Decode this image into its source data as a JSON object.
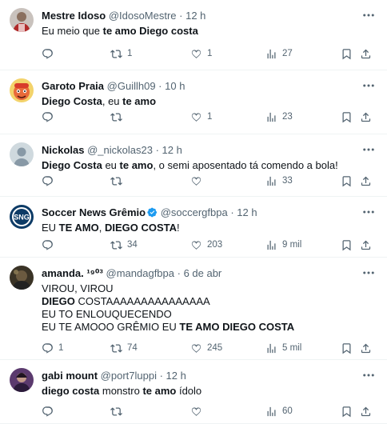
{
  "tweets": [
    {
      "name": "Mestre Idoso",
      "handle": "@IdosoMestre",
      "time": "12 h",
      "avatar": "user-photo",
      "lines": [
        [
          {
            "t": "Eu meio que ",
            "b": false
          },
          {
            "t": "te amo Diego costa",
            "b": true
          }
        ]
      ],
      "replies": "",
      "retweets": "1",
      "likes": "1",
      "views": "27"
    },
    {
      "name": "Garoto Praia",
      "handle": "@Guillh09",
      "time": "10 h",
      "avatar": "cartoon-character",
      "lines": [
        [
          {
            "t": "Diego Costa",
            "b": true
          },
          {
            "t": ", eu ",
            "b": false
          },
          {
            "t": "te amo",
            "b": true
          }
        ]
      ],
      "replies": "",
      "retweets": "",
      "likes": "1",
      "views": "23"
    },
    {
      "name": "Nickolas",
      "handle": "@_nickolas23",
      "time": "12 h",
      "avatar": "default-user",
      "lines": [
        [
          {
            "t": "Diego Costa",
            "b": true
          },
          {
            "t": " eu ",
            "b": false
          },
          {
            "t": "te amo",
            "b": true
          },
          {
            "t": ", o semi aposentado tá comendo a bola!",
            "b": false
          }
        ]
      ],
      "replies": "",
      "retweets": "",
      "likes": "",
      "views": "33"
    },
    {
      "name": "Soccer News Grêmio",
      "handle": "@soccergfbpa",
      "time": "12 h",
      "avatar": "soccer-news-logo",
      "verified": true,
      "lines": [
        [
          {
            "t": "EU ",
            "b": false
          },
          {
            "t": "TE AMO",
            "b": true
          },
          {
            "t": ", ",
            "b": false
          },
          {
            "t": "DIEGO COSTA",
            "b": true
          },
          {
            "t": "!",
            "b": false
          }
        ]
      ],
      "replies": "",
      "retweets": "34",
      "likes": "203",
      "views": "9 mil"
    },
    {
      "name": "amanda. ¹⁹⁰³",
      "handle": "@mandagfbpa",
      "time": "6 de abr",
      "avatar": "user-photo-dark",
      "lines": [
        [
          {
            "t": "VIROU, VIROU",
            "b": false
          }
        ],
        [
          {
            "t": "DIEGO",
            "b": true
          },
          {
            "t": " COSTAAAAAAAAAAAAAAA",
            "b": false
          }
        ],
        [
          {
            "t": "EU TO ENLOUQUECENDO",
            "b": false
          }
        ],
        [
          {
            "t": "EU TE AMOOO GRÊMIO EU ",
            "b": false
          },
          {
            "t": "TE AMO DIEGO COSTA",
            "b": true
          }
        ]
      ],
      "replies": "1",
      "retweets": "74",
      "likes": "245",
      "views": "5 mil"
    },
    {
      "name": "gabi mount",
      "handle": "@port7luppi",
      "time": "12 h",
      "avatar": "user-photo-purple",
      "lines": [
        [
          {
            "t": "diego costa",
            "b": true
          },
          {
            "t": " monstro ",
            "b": false
          },
          {
            "t": "te amo",
            "b": true
          },
          {
            "t": " ídolo",
            "b": false
          }
        ]
      ],
      "replies": "",
      "retweets": "",
      "likes": "",
      "views": "60"
    }
  ],
  "icons": {
    "reply": "reply-icon",
    "retweet": "retweet-icon",
    "like": "like-icon",
    "views": "views-icon",
    "bookmark": "bookmark-icon",
    "share": "share-icon",
    "more": "more-icon",
    "verified": "verified-badge-icon"
  },
  "colors": {
    "text": "#0f1419",
    "secondary": "#536471",
    "verified": "#1d9bf0",
    "divider": "#eff3f4"
  }
}
